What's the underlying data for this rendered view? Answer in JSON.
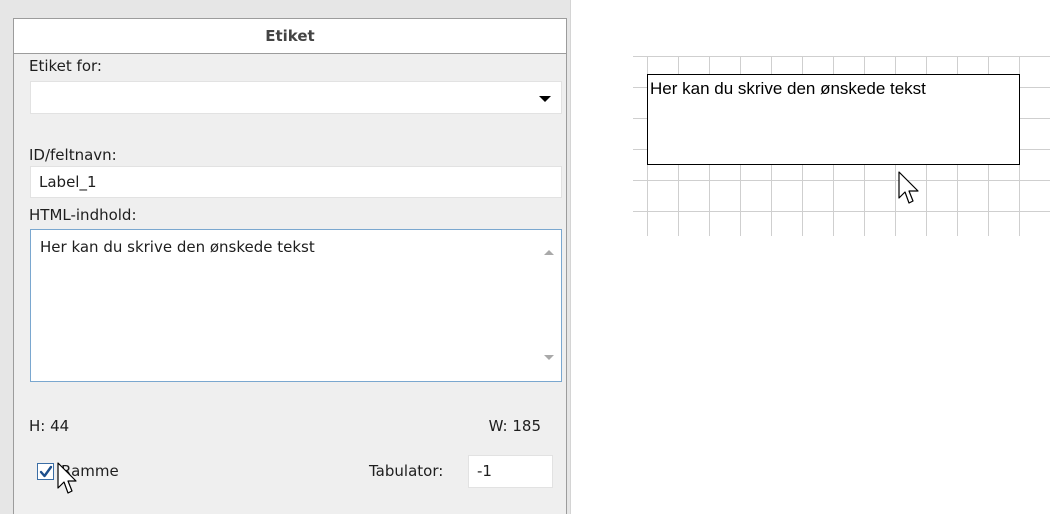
{
  "panel": {
    "title": "Etiket",
    "label_for": {
      "label": "Etiket for:",
      "value": ""
    },
    "id_field": {
      "label": "ID/feltnavn:",
      "value": "Label_1"
    },
    "html_content": {
      "label": "HTML-indhold:",
      "value": "Her kan du skrive den ønskede tekst"
    },
    "height_label": "H: 44",
    "width_label": "W: 185",
    "frame_checkbox": {
      "label": "Ramme",
      "checked": true
    },
    "tab_index": {
      "label": "Tabulator:",
      "value": "-1"
    }
  },
  "canvas": {
    "label_text": "Her kan du skrive den ønskede tekst"
  },
  "icons": {
    "select": "chevron-down-icon",
    "check": "checkmark-icon",
    "cursor": "arrow-cursor-icon"
  },
  "colors": {
    "panel_bg": "#efefef",
    "outer_bg": "#e6e6e6",
    "textarea_border": "#7aa7cf",
    "checkbox_border": "#3b6ea5",
    "grid_line": "#cfcfcf"
  }
}
